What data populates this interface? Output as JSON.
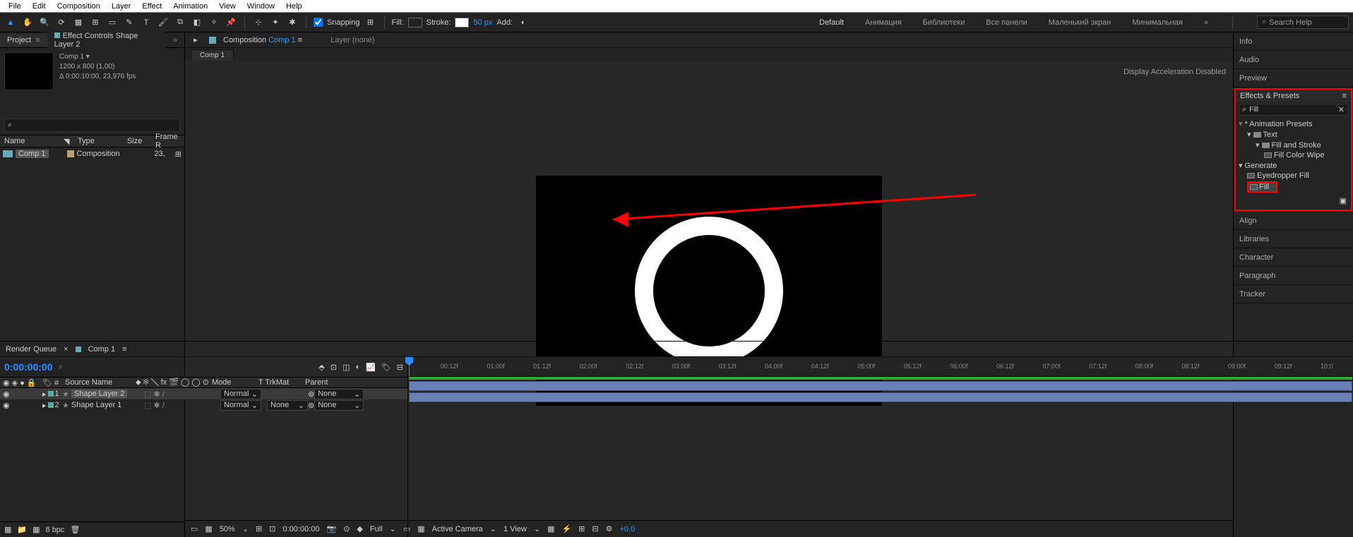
{
  "menu": {
    "items": [
      "File",
      "Edit",
      "Composition",
      "Layer",
      "Effect",
      "Animation",
      "View",
      "Window",
      "Help"
    ]
  },
  "toolbar": {
    "snapping": "Snapping",
    "fill_label": "Fill:",
    "stroke_label": "Stroke:",
    "stroke_px": "50 px",
    "add_label": "Add:",
    "workspace": "Default",
    "ws_links": [
      "Анимация",
      "Библиотеки",
      "Все панели",
      "Маленький экран",
      "Минимальная"
    ],
    "more": "»",
    "search_ph": "Search Help"
  },
  "left": {
    "tabs": {
      "project": "Project",
      "ec": "Effect Controls Shape Layer 2",
      "more": "»"
    },
    "comp_name": "Comp 1 ▾",
    "dims": "1200 x 800 (1,00)",
    "duration": "Δ 0:00:10:00, 23,976 fps",
    "cols": {
      "name": "Name",
      "type": "Type",
      "size": "Size",
      "fr": "Frame R"
    },
    "row": {
      "name": "Comp 1",
      "type": "Composition",
      "fr": "23,"
    },
    "bottom": {
      "bpc": "8 bpc"
    }
  },
  "center": {
    "tabs": {
      "comp_prefix": "Composition",
      "comp_name": "Comp 1",
      "layer": "Layer (none)",
      "comp_sub": "Comp 1"
    },
    "accel": "Display Acceleration Disabled",
    "vt": {
      "zoom": "50%",
      "time": "0:00:00:00",
      "res": "Full",
      "cam": "Active Camera",
      "view": "1 View",
      "exp": "+0,0"
    }
  },
  "right": {
    "stacks": [
      "Info",
      "Audio",
      "Preview"
    ],
    "effects_title": "Effects & Presets",
    "search_val": "Fill",
    "anim_presets": "* Animation Presets",
    "text": "Text",
    "fillstroke": "Fill and Stroke",
    "fillwipe": "Fill Color Wipe",
    "generate": "Generate",
    "eyedrop": "Eyedropper Fill",
    "fill": "Fill",
    "stacks2": [
      "Align",
      "Libraries",
      "Character",
      "Paragraph",
      "Tracker"
    ]
  },
  "timeline": {
    "tabs": {
      "rq": "Render Queue",
      "comp": "Comp 1"
    },
    "timecode": "0:00:00:00",
    "cols": {
      "src": "Source Name",
      "mode": "Mode",
      "trk": "T  TrkMat",
      "par": "Parent",
      "sw": "⬥ ✻ ╲ fx 🎬 ◯ ◯ ⊙"
    },
    "layers": [
      {
        "idx": "1",
        "name": "Shape Layer 2",
        "mode": "Normal",
        "par": "None"
      },
      {
        "idx": "2",
        "name": "Shape Layer 1",
        "mode": "Normal",
        "par": "None"
      }
    ],
    "ticks": [
      "00:12f",
      "01:00f",
      "01:12f",
      "02:00f",
      "02:12f",
      "03:00f",
      "03:12f",
      "04:00f",
      "04:12f",
      "05:00f",
      "05:12f",
      "06:00f",
      "06:12f",
      "07:00f",
      "07:12f",
      "08:00f",
      "08:12f",
      "09:00f",
      "09:12f",
      "10:0"
    ]
  }
}
